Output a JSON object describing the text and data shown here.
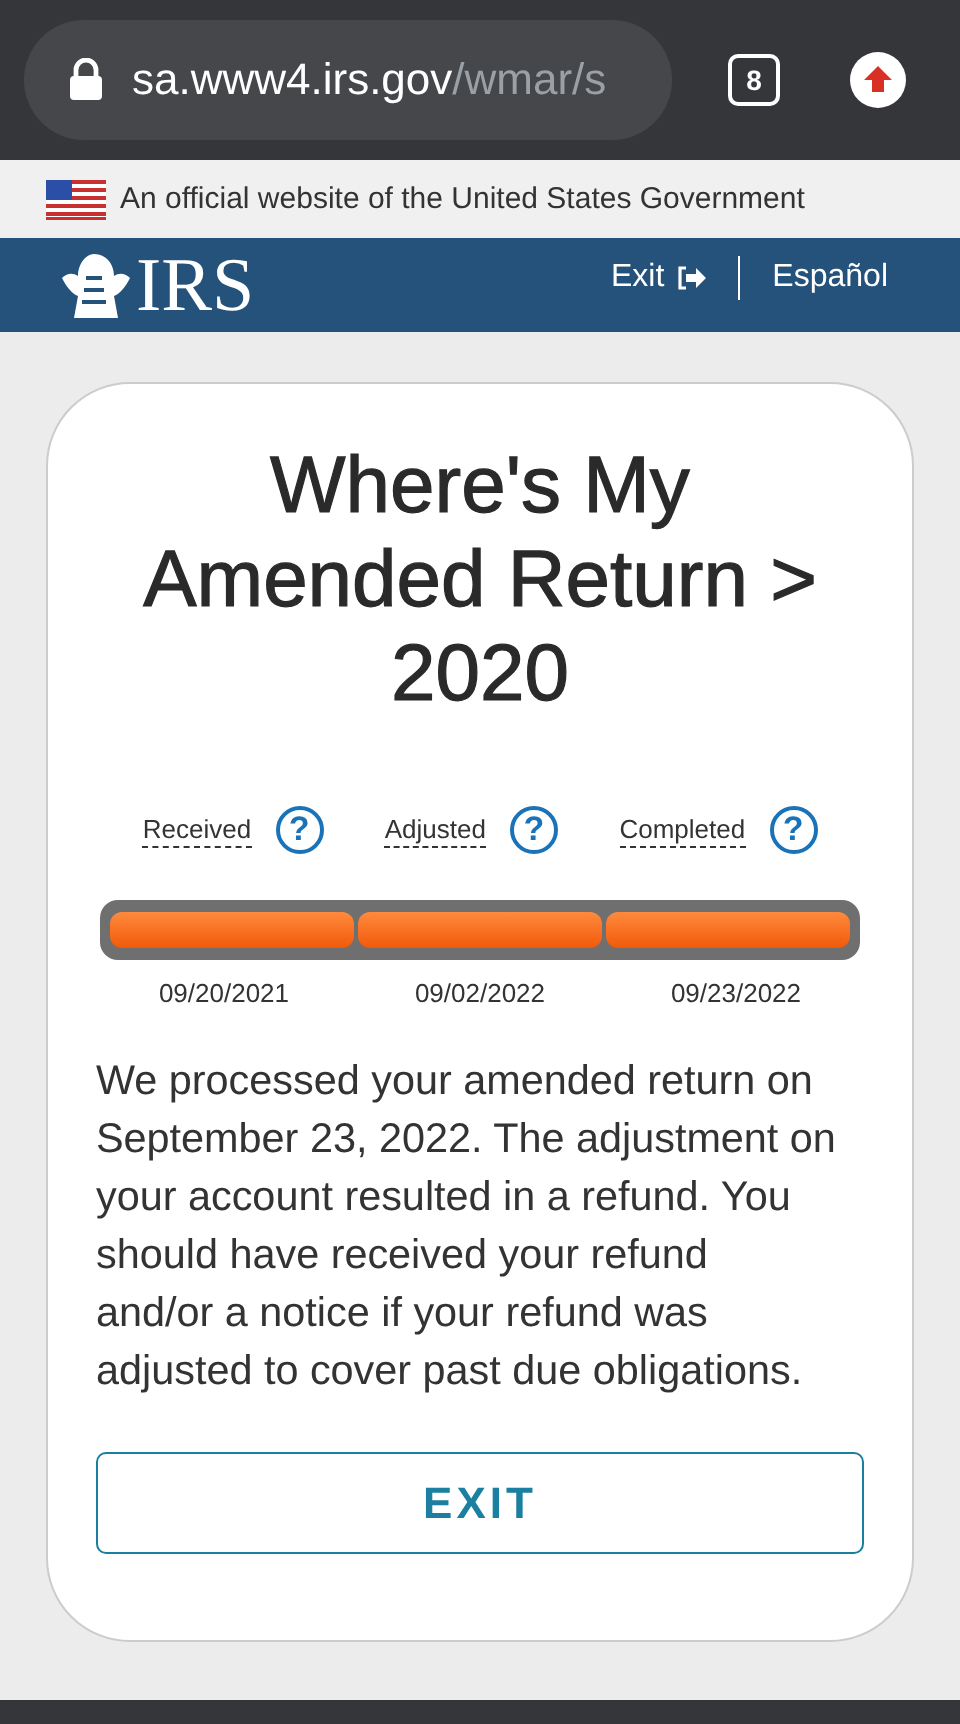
{
  "browser": {
    "url_host": "sa.www4.irs.gov",
    "url_path": "/wmar/s",
    "tab_count": "8"
  },
  "gov_banner": {
    "text": "An official website of the United States Government"
  },
  "header": {
    "logo": "IRS",
    "exit": "Exit",
    "language": "Español"
  },
  "title": "Where's My Amended Return > 2020",
  "steps": [
    {
      "label": "Received",
      "help": "?",
      "date": "09/20/2021",
      "done": true
    },
    {
      "label": "Adjusted",
      "help": "?",
      "date": "09/02/2022",
      "done": true
    },
    {
      "label": "Completed",
      "help": "?",
      "date": "09/23/2022",
      "done": true
    }
  ],
  "message": "We processed your amended return on September 23, 2022. The adjustment on your account resulted in a refund. You should have received your refund and/or a notice if your refund was adjusted to cover past due obligations.",
  "exit_button": "EXIT"
}
